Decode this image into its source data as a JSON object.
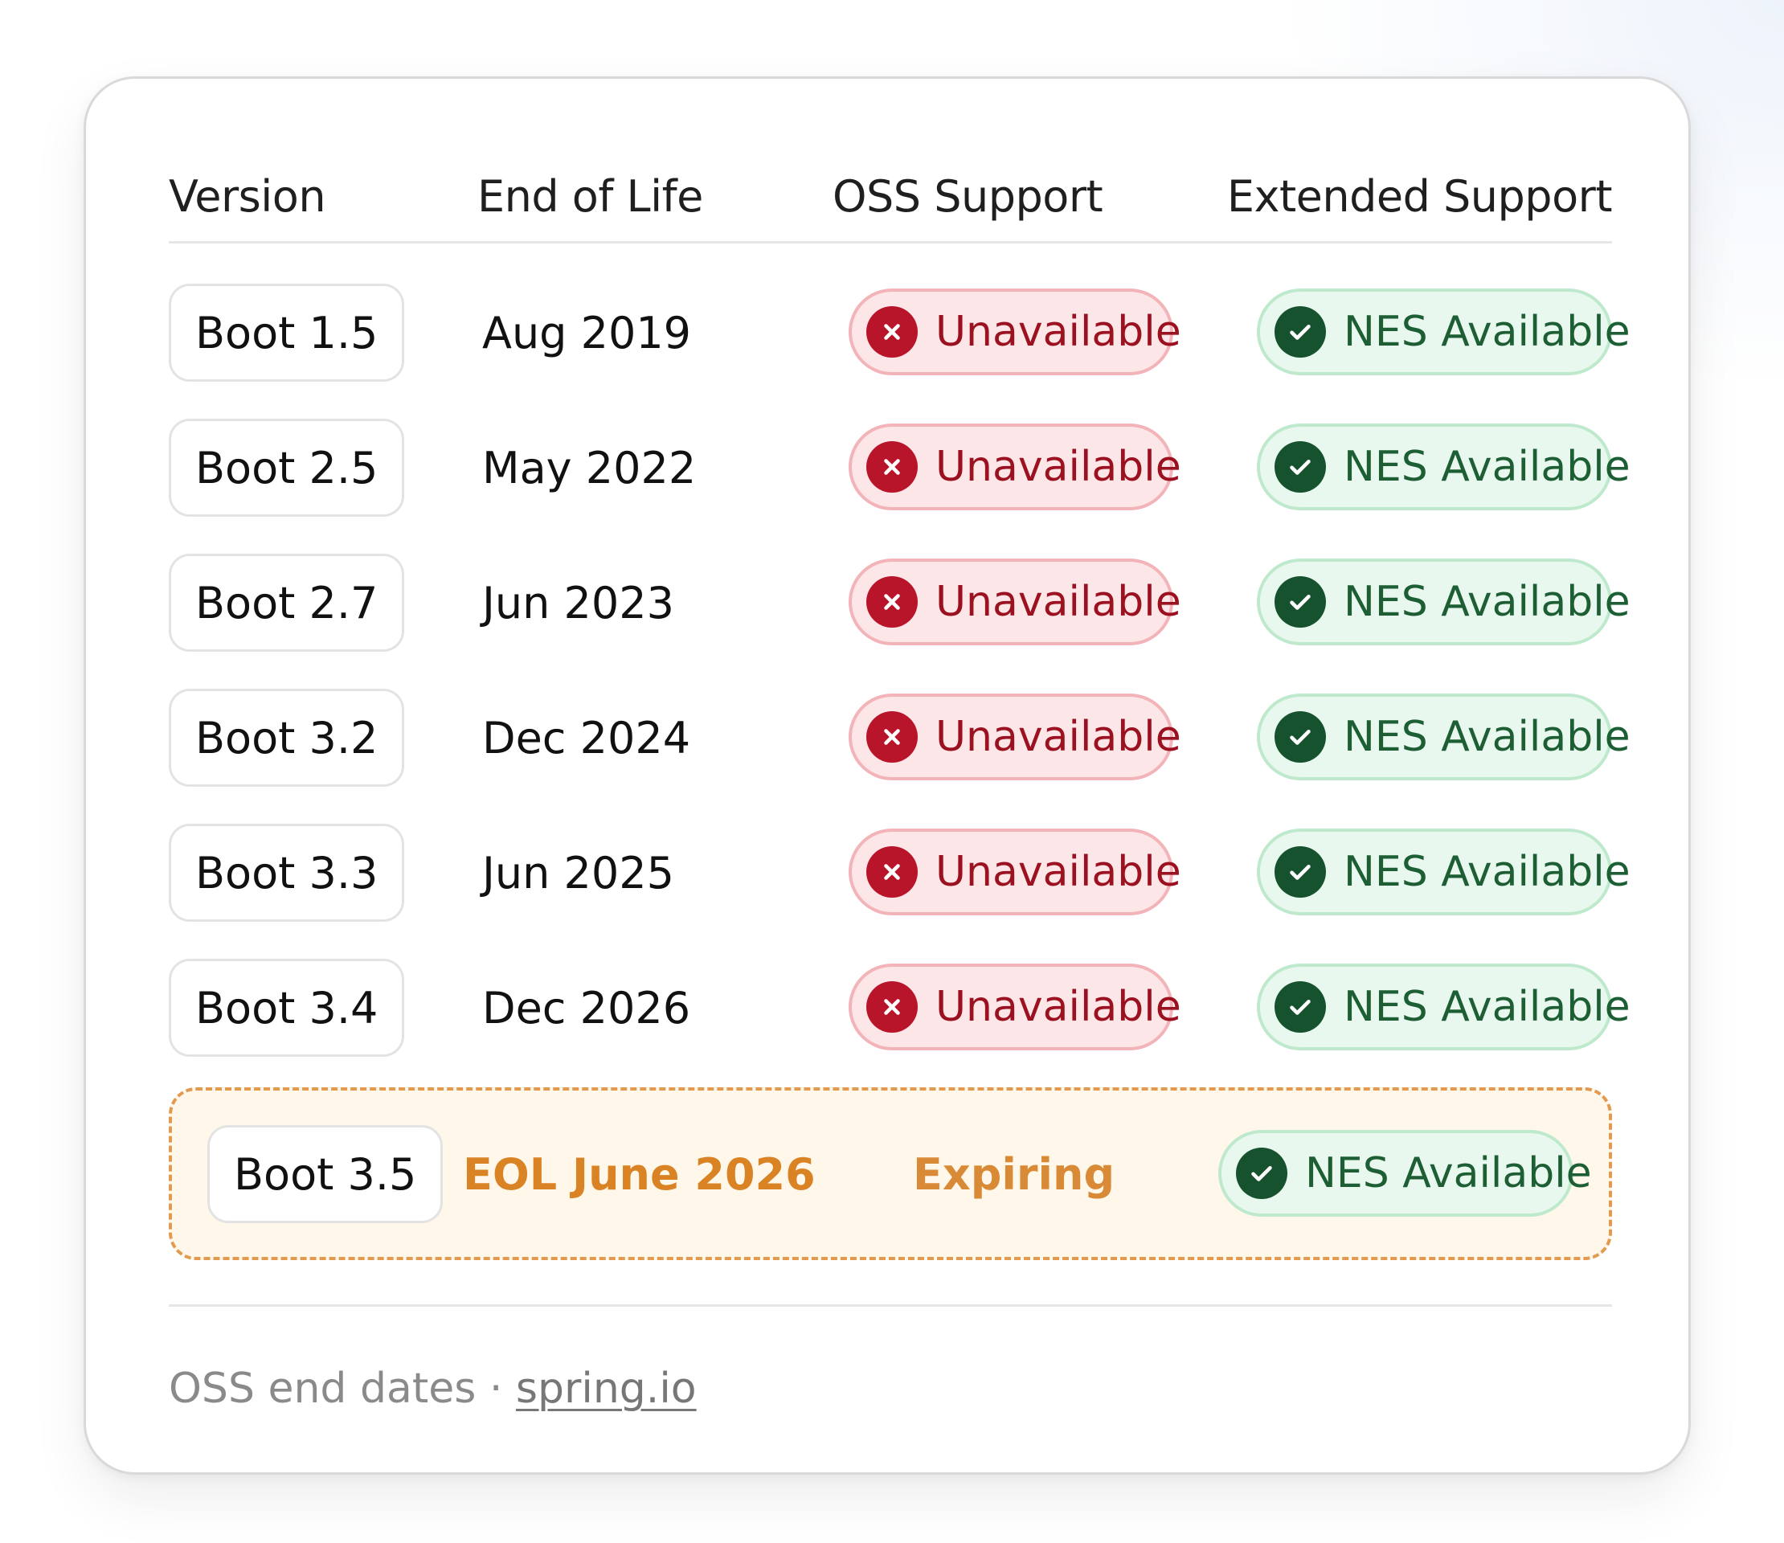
{
  "table": {
    "headers": {
      "version": "Version",
      "end_of_life": "End of Life",
      "oss_support": "OSS Support",
      "extended_support": "Extended Support"
    },
    "rows": [
      {
        "version": "Boot 1.5",
        "eol": "Aug 2019",
        "oss": "Unavailable",
        "ext": "NES Available"
      },
      {
        "version": "Boot 2.5",
        "eol": "May 2022",
        "oss": "Unavailable",
        "ext": "NES Available"
      },
      {
        "version": "Boot 2.7",
        "eol": "Jun 2023",
        "oss": "Unavailable",
        "ext": "NES Available"
      },
      {
        "version": "Boot 3.2",
        "eol": "Dec 2024",
        "oss": "Unavailable",
        "ext": "NES Available"
      },
      {
        "version": "Boot 3.3",
        "eol": "Jun 2025",
        "oss": "Unavailable",
        "ext": "NES Available"
      },
      {
        "version": "Boot 3.4",
        "eol": "Dec 2026",
        "oss": "Unavailable",
        "ext": "NES Available"
      }
    ],
    "expiring_row": {
      "version": "Boot 3.5",
      "eol": "EOL June 2026",
      "oss": "Expiring",
      "ext": "NES Available"
    }
  },
  "footer": {
    "text": "OSS end dates · ",
    "link": "spring.io"
  },
  "icons": {
    "unavailable": "x-circle-icon",
    "available": "check-circle-icon"
  },
  "colors": {
    "unavailable_text": "#9b1120",
    "unavailable_bg": "#fde6e8",
    "available_text": "#1d5e34",
    "available_bg": "#e9f8ee",
    "expiring_accent": "#d98325"
  }
}
